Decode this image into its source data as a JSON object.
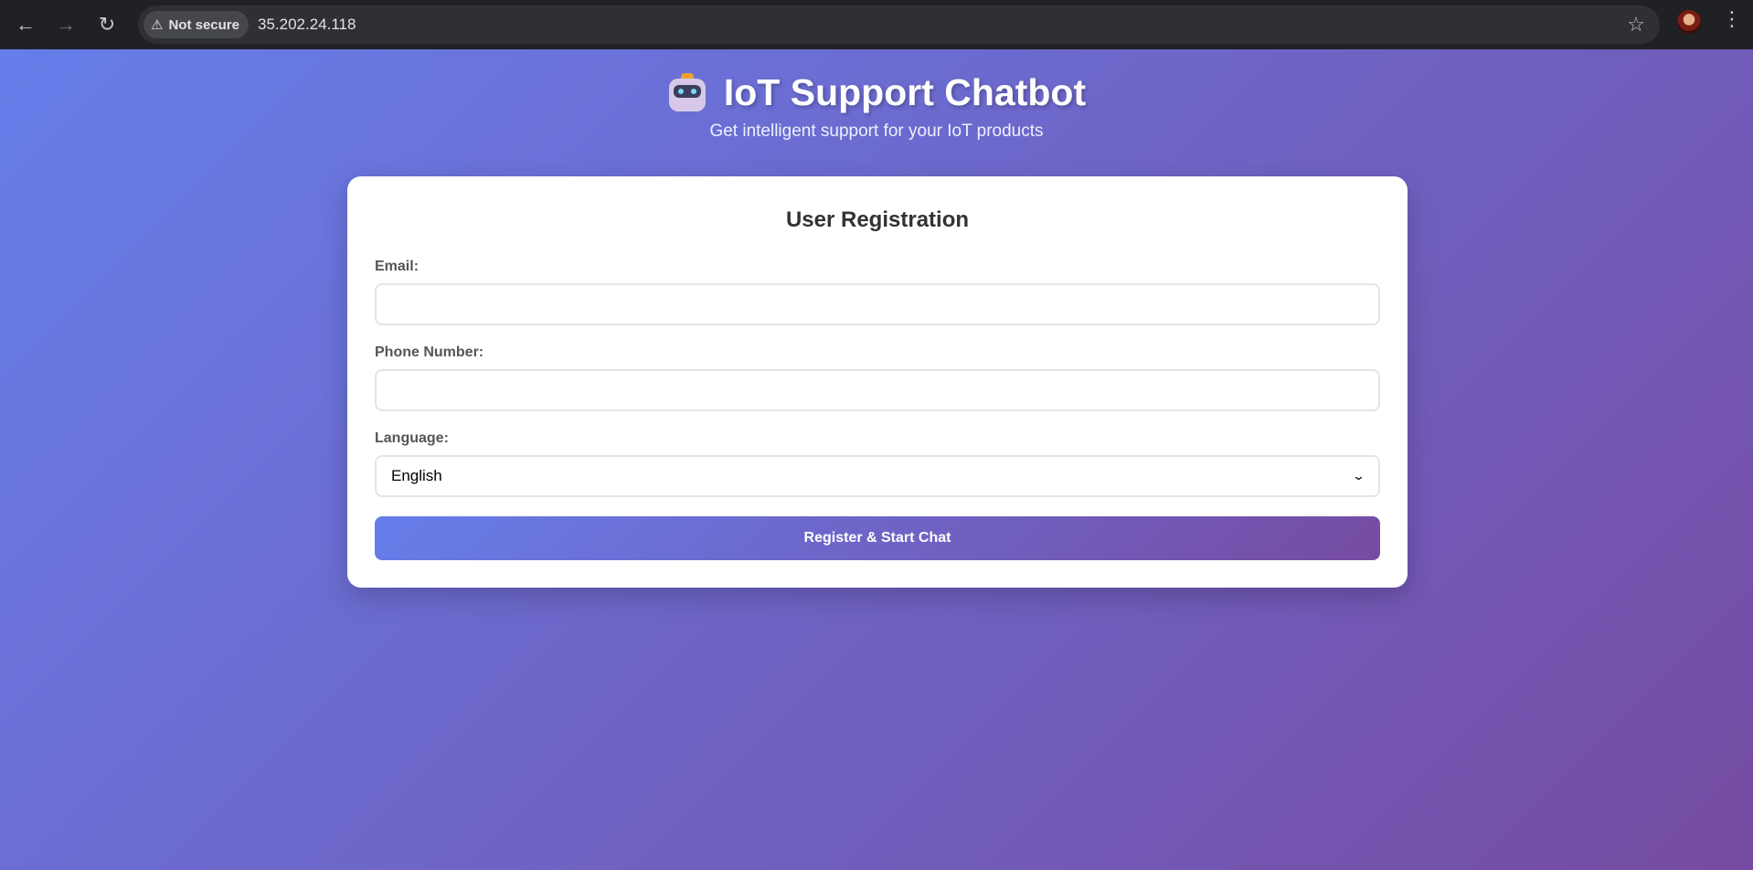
{
  "browser": {
    "security_label": "Not secure",
    "url": "35.202.24.118",
    "icons": [
      "back-arrow-icon",
      "forward-arrow-icon",
      "reload-icon",
      "warning-icon",
      "star-icon",
      "menu-icon"
    ]
  },
  "header": {
    "title": "IoT Support Chatbot",
    "subtitle": "Get intelligent support for your IoT products",
    "icon": "robot-icon"
  },
  "registration": {
    "title": "User Registration",
    "email_label": "Email:",
    "email_value": "",
    "phone_label": "Phone Number:",
    "phone_value": "",
    "language_label": "Language:",
    "language_selected": "English",
    "submit_label": "Register & Start Chat"
  },
  "colors": {
    "gradient_start": "#667eea",
    "gradient_end": "#764ba2",
    "card_background": "#ffffff",
    "chrome_background": "#202124"
  }
}
